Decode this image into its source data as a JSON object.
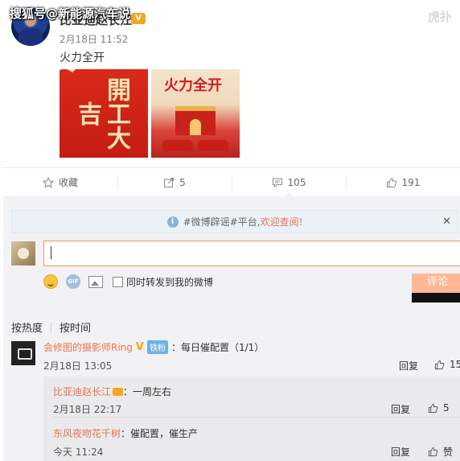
{
  "watermark": "搜狐号@新能源汽车说",
  "corner_mark": "虎扑",
  "post": {
    "author": "比亚迪赵长江",
    "time": "2月18日 11:52",
    "text": "火力全开",
    "image1_text": "開工大吉",
    "image2_title": "火力全开"
  },
  "actions": {
    "favorite": "收藏",
    "repost_count": "5",
    "comment_count": "105",
    "like_count": "191"
  },
  "notice": {
    "prefix": "#微博辟谣#平台,",
    "link": "欢迎查阅!"
  },
  "composer": {
    "repost_label": "同时转发到我的微博",
    "submit_label": "评论",
    "gif_label": "GIF"
  },
  "sort": {
    "hot": "按热度",
    "time": "按时间"
  },
  "comments": [
    {
      "user": "会修图的摄影师Ring",
      "v": "V",
      "fan_badge": "铁粉",
      "text": "：每日催配置（1/1）",
      "time": "2月18日 13:05",
      "reply": "回复",
      "likes": "15",
      "replies": [
        {
          "user": "比亚迪赵长江",
          "text": "：一周左右",
          "time": "2月18日 22:17",
          "reply": "回复",
          "likes": "5"
        },
        {
          "user": "东风夜吻花千树",
          "text": "：催配置，催生产",
          "time": "今天 11:24",
          "reply": "回复",
          "likes": "赞"
        }
      ]
    }
  ],
  "colors": {
    "accent": "#eb7350",
    "notice_bg": "#eaf2f8",
    "panel_bg": "#f2f2f5"
  }
}
